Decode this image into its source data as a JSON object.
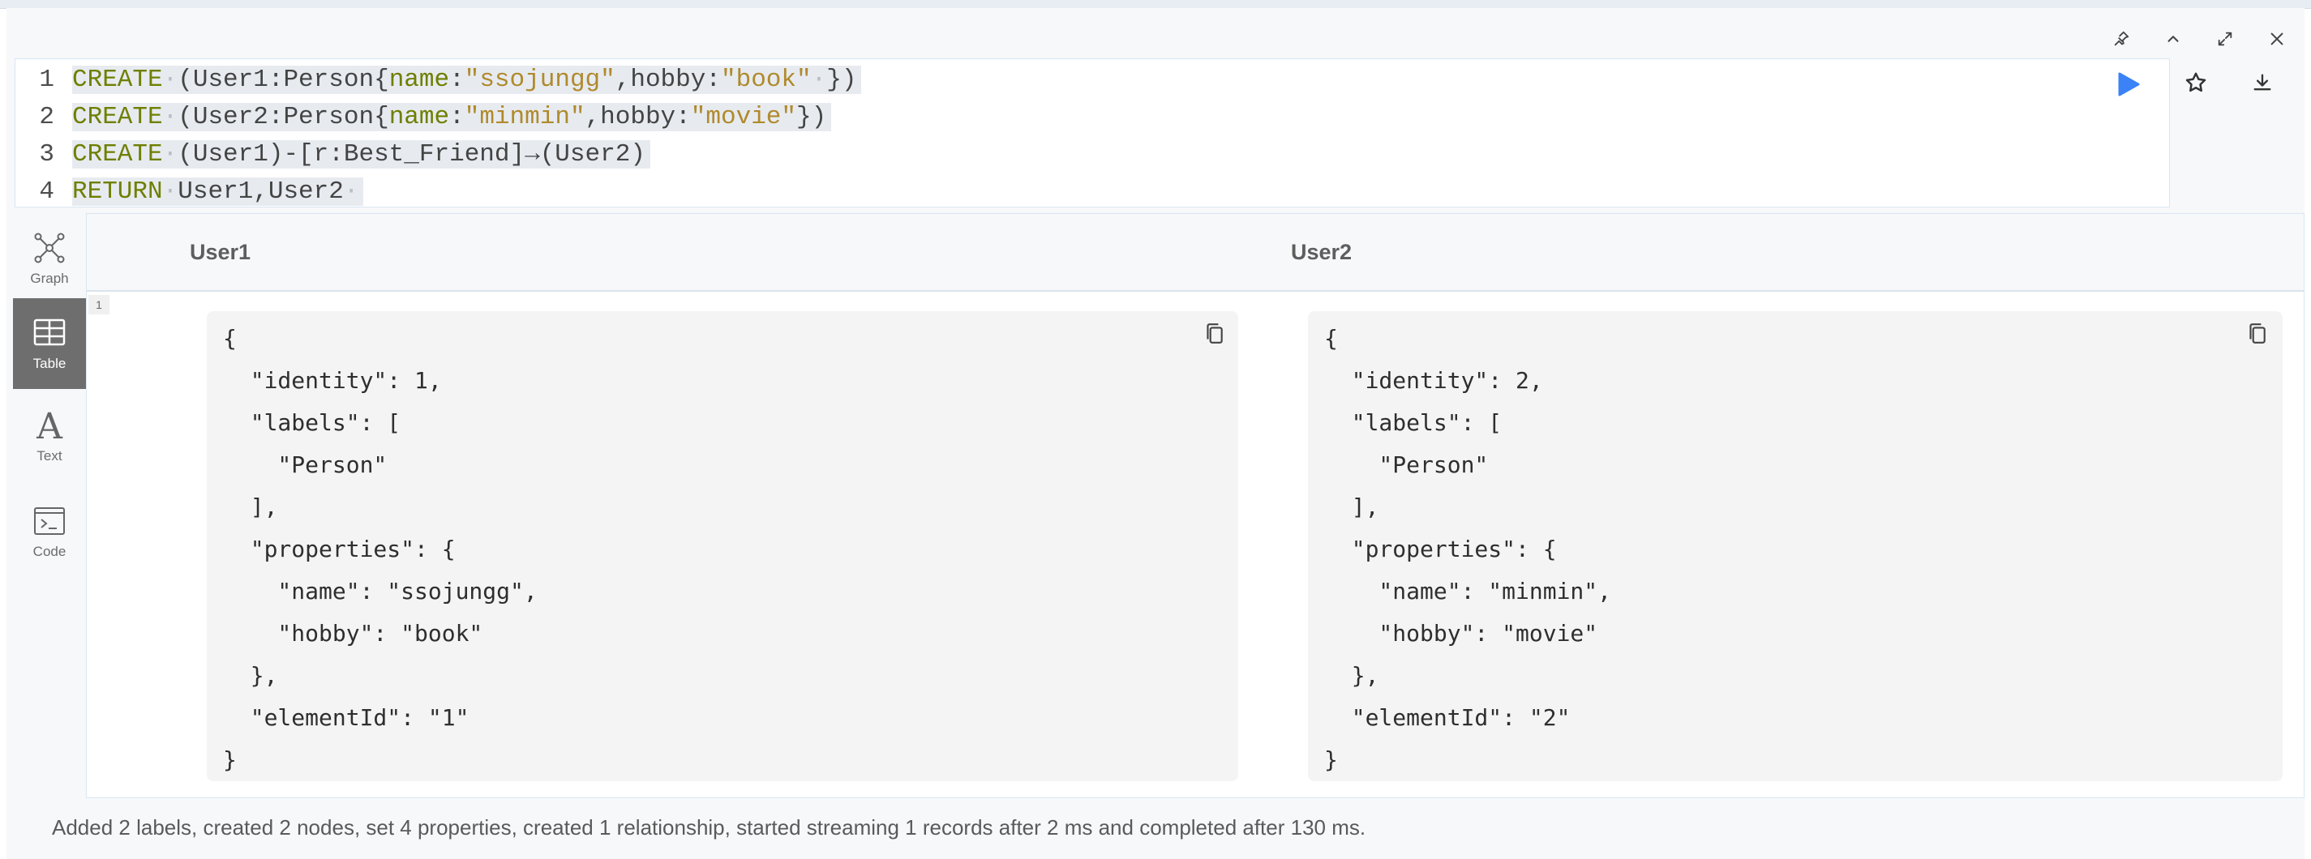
{
  "editor": {
    "lines": [
      {
        "num": "1",
        "tokens": [
          {
            "t": "CREATE",
            "c": "kw"
          },
          {
            "t": "·",
            "c": "ws"
          },
          {
            "t": "(User1:Person{",
            "c": "plain"
          },
          {
            "t": "name",
            "c": "prop"
          },
          {
            "t": ":",
            "c": "plain"
          },
          {
            "t": "\"ssojungg\"",
            "c": "str"
          },
          {
            "t": ",hobby:",
            "c": "plain"
          },
          {
            "t": "\"book\"",
            "c": "str"
          },
          {
            "t": "·",
            "c": "ws"
          },
          {
            "t": "})",
            "c": "plain"
          }
        ]
      },
      {
        "num": "2",
        "tokens": [
          {
            "t": "CREATE",
            "c": "kw"
          },
          {
            "t": "·",
            "c": "ws"
          },
          {
            "t": "(User2:Person{",
            "c": "plain"
          },
          {
            "t": "name",
            "c": "prop"
          },
          {
            "t": ":",
            "c": "plain"
          },
          {
            "t": "\"minmin\"",
            "c": "str"
          },
          {
            "t": ",hobby:",
            "c": "plain"
          },
          {
            "t": "\"movie\"",
            "c": "str"
          },
          {
            "t": "})",
            "c": "plain"
          }
        ]
      },
      {
        "num": "3",
        "tokens": [
          {
            "t": "CREATE",
            "c": "kw"
          },
          {
            "t": "·",
            "c": "ws"
          },
          {
            "t": "(User1)-[r:Best_Friend]→(User2)",
            "c": "plain"
          }
        ]
      },
      {
        "num": "4",
        "tokens": [
          {
            "t": "RETURN",
            "c": "kw"
          },
          {
            "t": "·",
            "c": "ws"
          },
          {
            "t": "User1,User2",
            "c": "plain"
          },
          {
            "t": "·",
            "c": "ws"
          }
        ]
      }
    ]
  },
  "sidebar": {
    "graph": "Graph",
    "table": "Table",
    "text": "Text",
    "code": "Code"
  },
  "results": {
    "columns": [
      "User1",
      "User2"
    ],
    "row_number": "1",
    "cells": [
      [
        "{",
        "  \"identity\": 1,",
        "  \"labels\": [",
        "    \"Person\"",
        "  ],",
        "  \"properties\": {",
        "    \"name\": \"ssojungg\",",
        "    \"hobby\": \"book\"",
        "  },",
        "  \"elementId\": \"1\"",
        "}"
      ],
      [
        "{",
        "  \"identity\": 2,",
        "  \"labels\": [",
        "    \"Person\"",
        "  ],",
        "  \"properties\": {",
        "    \"name\": \"minmin\",",
        "    \"hobby\": \"movie\"",
        "  },",
        "  \"elementId\": \"2\"",
        "}"
      ]
    ]
  },
  "status": "Added 2 labels, created 2 nodes, set 4 properties, created 1 relationship, started streaming 1 records after 2 ms and completed after 130 ms.",
  "colors": {
    "run_button": "#3b82f6",
    "keyword": "#6f7f00",
    "string": "#b08a2c",
    "sidebar_active": "#6e6e6e"
  },
  "icons": [
    "pin-icon",
    "collapse-up-icon",
    "fullscreen-icon",
    "close-icon",
    "run-icon",
    "star-icon",
    "download-icon",
    "graph-icon",
    "table-icon",
    "text-icon",
    "code-icon",
    "copy-icon"
  ]
}
